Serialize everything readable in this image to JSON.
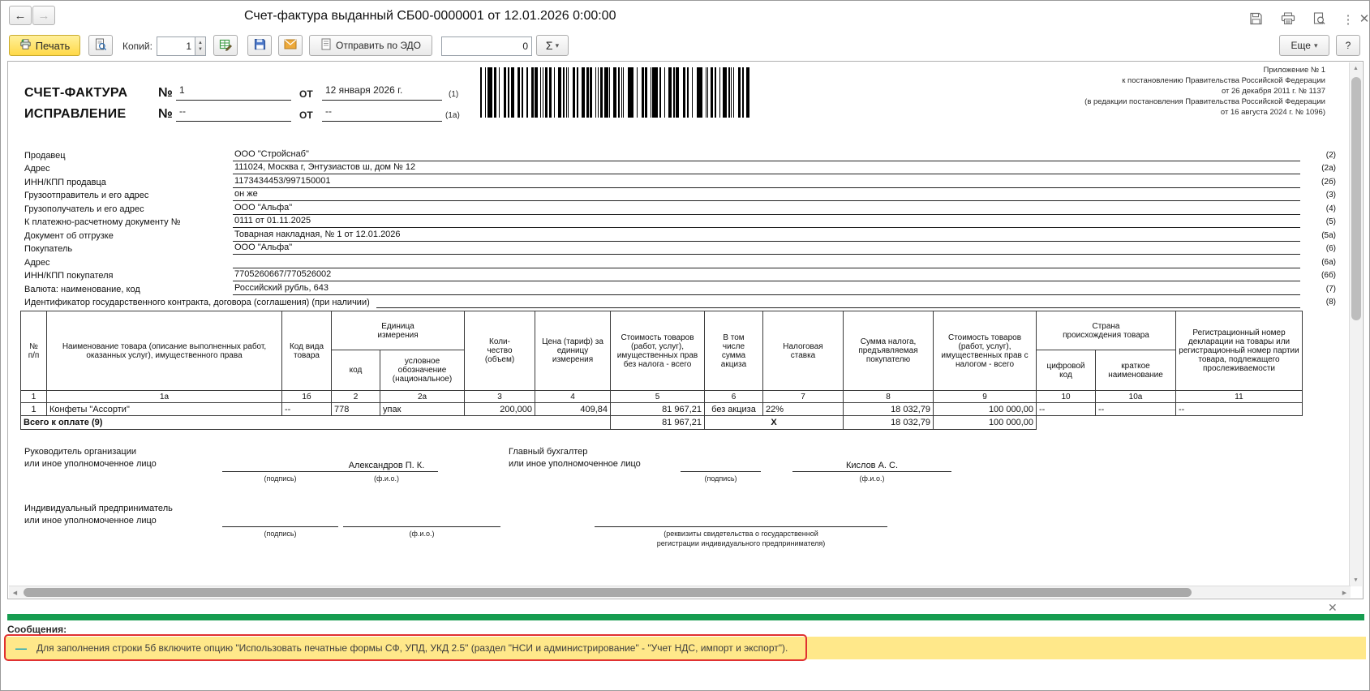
{
  "window": {
    "title": "Счет-фактура выданный СБ00-0000001 от 12.01.2026 0:00:00",
    "more_label": "Еще",
    "help_label": "?"
  },
  "toolbar": {
    "print_label": "Печать",
    "copies_label": "Копий:",
    "copies_value": "1",
    "edo_label": "Отправить по ЭДО",
    "count_value": "0",
    "sigma_label": "Σ"
  },
  "legal_note": {
    "line1": "Приложение № 1",
    "line2": "к постановлению Правительства Российской Федерации",
    "line3": "от 26 декабря 2011 г. № 1137",
    "line4": "(в редакции постановления Правительства Российской Федерации",
    "line5": "от 16 августа 2024 г. № 1096)"
  },
  "invoice_header": {
    "title_label": "СЧЕТ-ФАКТУРА",
    "number_sign": "№",
    "number": "1",
    "from_label": "ОТ",
    "date": "12 января 2026 г.",
    "marker": "(1)",
    "corr_label": "ИСПРАВЛЕНИЕ",
    "corr_number_sign": "№",
    "corr_number": "--",
    "corr_from_label": "ОТ",
    "corr_date": "--",
    "corr_marker": "(1а)"
  },
  "fields": [
    {
      "label": "Продавец",
      "value": "ООО \"Стройснаб\"",
      "marker": "(2)"
    },
    {
      "label": "Адрес",
      "value": "111024, Москва г, Энтузиастов ш, дом № 12",
      "marker": "(2а)"
    },
    {
      "label": "ИНН/КПП продавца",
      "value": "1173434453/997150001",
      "marker": "(2б)"
    },
    {
      "label": "Грузоотправитель и его адрес",
      "value": "он же",
      "marker": "(3)"
    },
    {
      "label": "Грузополучатель и его адрес",
      "value": "ООО \"Альфа\"",
      "marker": "(4)"
    },
    {
      "label": "К платежно-расчетному документу №",
      "value": "0111 от 01.11.2025",
      "marker": "(5)"
    },
    {
      "label": "Документ об отгрузке",
      "value": "Товарная накладная, № 1 от 12.01.2026",
      "marker": "(5а)"
    },
    {
      "label": "Покупатель",
      "value": "ООО \"Альфа\"",
      "marker": "(6)"
    },
    {
      "label": "Адрес",
      "value": "",
      "marker": "(6а)"
    },
    {
      "label": "ИНН/КПП покупателя",
      "value": "7705260667/770526002",
      "marker": "(6б)"
    },
    {
      "label": "Валюта: наименование, код",
      "value": "Российский рубль, 643",
      "marker": "(7)"
    },
    {
      "label": "Идентификатор государственного контракта, договора (соглашения) (при наличии)",
      "value": "",
      "marker": "(8)"
    }
  ],
  "table": {
    "head": {
      "num": "№\nп/п",
      "name": "Наименование товара (описание выполненных работ, оказанных услуг), имущественного права",
      "kind": "Код вида товара",
      "unit": "Единица\nизмерения",
      "unit_code": "код",
      "unit_symbol": "условное обозначение (национальное)",
      "qty": "Коли-\nчество\n(объем)",
      "price": "Цена (тариф) за единицу измерения",
      "cost_wo_tax": "Стоимость товаров (работ, услуг), имущественных прав без налога - всего",
      "excise": "В том\nчисле\nсумма\nакциза",
      "rate": "Налоговая\nставка",
      "tax_sum": "Сумма налога, предъявляемая покупателю",
      "cost_w_tax": "Стоимость товаров (работ, услуг), имущественных прав с налогом - всего",
      "country": "Страна\nпроисхождения товара",
      "country_code": "цифровой\nкод",
      "country_name": "краткое\nнаименование",
      "reg_number": "Регистрационный номер декларации на товары или регистрационный номер партии товара, подлежащего прослеживаемости"
    },
    "nums": [
      "1",
      "1а",
      "1б",
      "2",
      "2а",
      "3",
      "4",
      "5",
      "6",
      "7",
      "8",
      "9",
      "10",
      "10а",
      "11"
    ],
    "rows": [
      [
        "1",
        "Конфеты \"Ассорти\"",
        "--",
        "778",
        "упак",
        "200,000",
        "409,84",
        "81 967,21",
        "без акциза",
        "22%",
        "18 032,79",
        "100 000,00",
        "--",
        "--",
        "--"
      ]
    ],
    "total": {
      "label": "Всего к оплате (9)",
      "cost_wo_tax": "81 967,21",
      "x_mark": "X",
      "tax_sum": "18 032,79",
      "cost_w_tax": "100 000,00"
    }
  },
  "signatures": {
    "head_label1": "Руководитель организации",
    "head_label2": "или иное уполномоченное лицо",
    "head_name": "Александров П. К.",
    "acct_label1": "Главный бухгалтер",
    "acct_label2": "или иное уполномоченное лицо",
    "acct_name": "Кислов А. С.",
    "ip_label1": "Индивидуальный предприниматель",
    "ip_label2": "или иное уполномоченное лицо",
    "sign_caption": "(подпись)",
    "name_caption": "(ф.и.о.)",
    "cert_caption1": "(реквизиты свидетельства о государственной",
    "cert_caption2": "регистрации индивидуального предпринимателя)"
  },
  "messages": {
    "panel_title": "Сообщения:",
    "marker": "—",
    "text": "Для заполнения строки 5б включите опцию \"Использовать печатные формы СФ, УПД, УКД 2.5\" (раздел \"НСИ и администрирование\" - \"Учет НДС, импорт и экспорт\")."
  },
  "colors": {
    "accent_green_bar": "#169c50",
    "message_bg": "#ffe88a",
    "highlight_border": "#e03131",
    "print_button_bg": "#ffdb4d",
    "message_marker": "#0aa0c0"
  }
}
